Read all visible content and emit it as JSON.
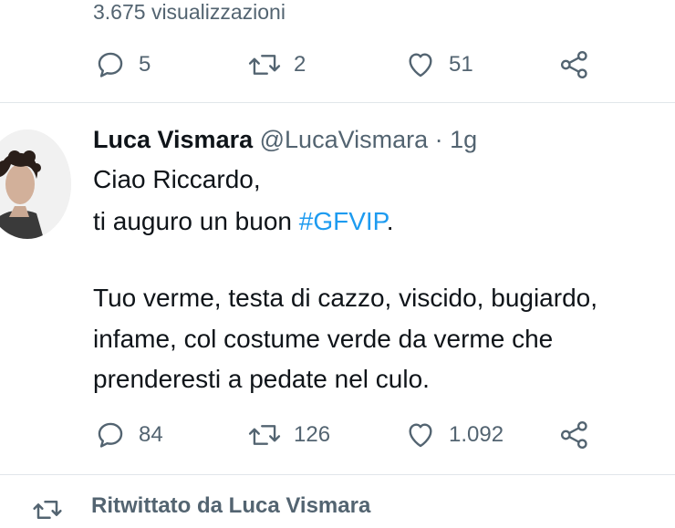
{
  "prev_tweet": {
    "views": "3.675 visualizzazioni",
    "actions": {
      "replies": "5",
      "retweets": "2",
      "likes": "51"
    }
  },
  "tweet": {
    "author": {
      "name": "Luca Vismara",
      "handle": "@LucaVismara",
      "separator": "·",
      "time": "1g"
    },
    "text": {
      "line1": "Ciao Riccardo,",
      "line2_prefix": "ti auguro un buon ",
      "hashtag": "#GFVIP",
      "line2_suffix": ".",
      "line3": "Tuo verme, testa di cazzo, viscido, bugiardo,",
      "line4": "infame, col costume verde da verme che",
      "line5": "prenderesti a pedate nel culo."
    },
    "actions": {
      "replies": "84",
      "retweets": "126",
      "likes": "1.092"
    }
  },
  "next": {
    "retweet_note": "Ritwittato da Luca Vismara"
  },
  "colors": {
    "text": "#0f1419",
    "secondary": "#536471",
    "link": "#1d9bf0",
    "divider": "#e1e6ea"
  }
}
